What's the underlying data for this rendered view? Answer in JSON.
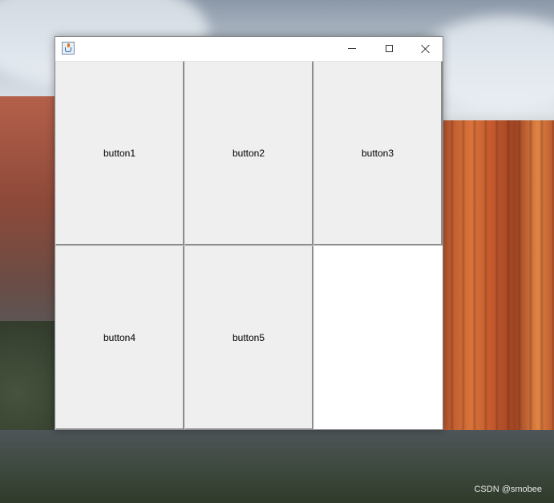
{
  "window": {
    "icon": "java-coffee-icon",
    "controls": {
      "minimize_icon": "minimize-icon",
      "maximize_icon": "maximize-icon",
      "close_icon": "close-icon"
    }
  },
  "buttons": [
    {
      "label": "button1"
    },
    {
      "label": "button2"
    },
    {
      "label": "button3"
    },
    {
      "label": "button4"
    },
    {
      "label": "button5"
    }
  ],
  "watermark": "CSDN @smobee",
  "colors": {
    "button_face": "#efefef",
    "button_shadow": "#8d8d8d",
    "window_bg": "#ffffff"
  }
}
